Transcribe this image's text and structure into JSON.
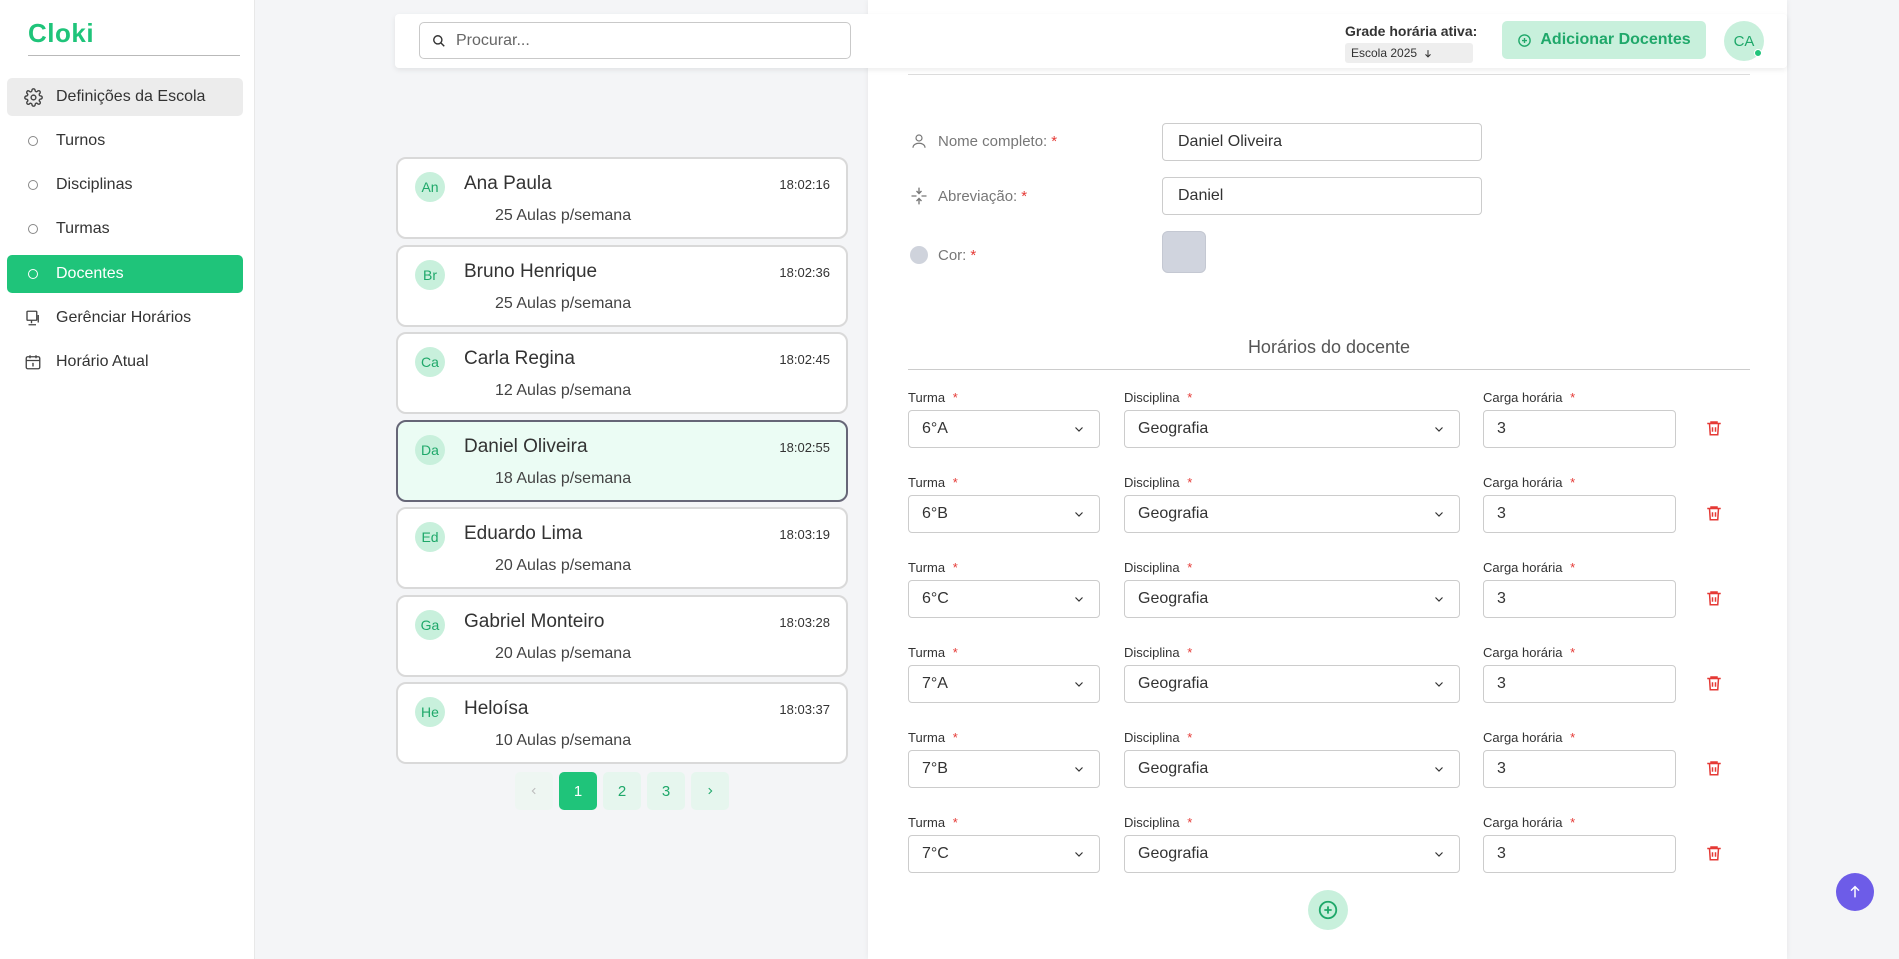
{
  "app": {
    "logo": "Cloki"
  },
  "sidebar": {
    "items": [
      {
        "label": "Definições da Escola",
        "icon": "gear-icon"
      },
      {
        "label": "Turnos",
        "icon": "circle-icon"
      },
      {
        "label": "Disciplinas",
        "icon": "circle-icon"
      },
      {
        "label": "Turmas",
        "icon": "circle-icon"
      },
      {
        "label": "Docentes",
        "icon": "circle-icon"
      },
      {
        "label": "Gerênciar Horários",
        "icon": "monitor-icon"
      },
      {
        "label": "Horário Atual",
        "icon": "calendar-icon"
      }
    ]
  },
  "topbar": {
    "search_placeholder": "Procurar...",
    "grade_label": "Grade horária ativa:",
    "grade_value": "Escola 2025",
    "add_button": "Adicionar Docentes",
    "user_initials": "CA"
  },
  "teachers": [
    {
      "initials": "An",
      "name": "Ana Paula",
      "time": "18:02:16",
      "count": "25 Aulas p/semana"
    },
    {
      "initials": "Br",
      "name": "Bruno Henrique",
      "time": "18:02:36",
      "count": "25 Aulas p/semana"
    },
    {
      "initials": "Ca",
      "name": "Carla Regina",
      "time": "18:02:45",
      "count": "12 Aulas p/semana"
    },
    {
      "initials": "Da",
      "name": "Daniel Oliveira",
      "time": "18:02:55",
      "count": "18 Aulas p/semana"
    },
    {
      "initials": "Ed",
      "name": "Eduardo Lima",
      "time": "18:03:19",
      "count": "20 Aulas p/semana"
    },
    {
      "initials": "Ga",
      "name": "Gabriel Monteiro",
      "time": "18:03:28",
      "count": "20 Aulas p/semana"
    },
    {
      "initials": "He",
      "name": "Heloísa",
      "time": "18:03:37",
      "count": "10 Aulas p/semana"
    }
  ],
  "pagination": {
    "pages": [
      "1",
      "2",
      "3"
    ],
    "current": "1"
  },
  "form": {
    "name_label": "Nome completo:",
    "name_value": "Daniel Oliveira",
    "abbr_label": "Abreviação:",
    "abbr_value": "Daniel",
    "color_label": "Cor:",
    "color_value": "#d0d4de",
    "required_mark": "*",
    "schedule_title": "Horários do docente",
    "col_turma": "Turma",
    "col_disciplina": "Disciplina",
    "col_carga": "Carga horária",
    "rows": [
      {
        "turma": "6°A",
        "disciplina": "Geografia",
        "carga": "3"
      },
      {
        "turma": "6°B",
        "disciplina": "Geografia",
        "carga": "3"
      },
      {
        "turma": "6°C",
        "disciplina": "Geografia",
        "carga": "3"
      },
      {
        "turma": "7°A",
        "disciplina": "Geografia",
        "carga": "3"
      },
      {
        "turma": "7°B",
        "disciplina": "Geografia",
        "carga": "3"
      },
      {
        "turma": "7°C",
        "disciplina": "Geografia",
        "carga": "3"
      }
    ]
  },
  "colors": {
    "accent": "#1fc47a",
    "accent_light": "#c8f0dc",
    "danger": "#e53935",
    "scroll_button": "#6d5ce8"
  }
}
